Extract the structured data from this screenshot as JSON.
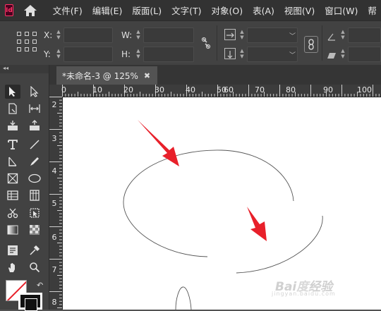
{
  "app": {
    "logo_text": "Id"
  },
  "menu": [
    "文件(F)",
    "编辑(E)",
    "版面(L)",
    "文字(T)",
    "对象(O)",
    "表(A)",
    "视图(V)",
    "窗口(W)",
    "帮"
  ],
  "control_panel": {
    "x_label": "X:",
    "y_label": "Y:",
    "w_label": "W:",
    "h_label": "H:",
    "x_value": "",
    "y_value": "",
    "w_value": "",
    "h_value": ""
  },
  "tools_panel": {
    "collapse_glyph": "◂◂"
  },
  "document_tab": {
    "title": "*未命名-3 @ 125%",
    "close_glyph": "✖"
  },
  "ruler_h": [
    "0",
    "10",
    "20",
    "30",
    "40",
    "50",
    "60",
    "70",
    "80",
    "90",
    "100"
  ],
  "ruler_v": [
    "2",
    "3",
    "4",
    "5",
    "6",
    "7",
    "8"
  ],
  "watermark": {
    "text": "Bai度经验",
    "sub": "jingyan.baidu.com"
  },
  "colors": {
    "menu_bg": "#323232",
    "panel_bg": "#424242",
    "arrow_red": "#e8202a",
    "canvas_bg": "#ffffff"
  }
}
